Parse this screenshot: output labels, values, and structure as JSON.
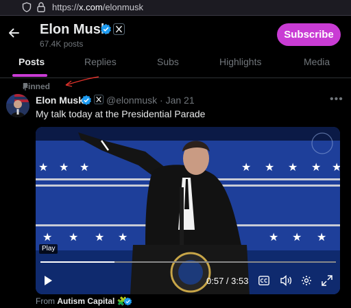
{
  "browser": {
    "url_prefix": "https://",
    "url_host": "x.com",
    "url_path": "/elonmusk"
  },
  "header": {
    "name": "Elon Musk",
    "post_count": "67.4K posts",
    "subscribe_label": "Subscribe"
  },
  "tabs": [
    {
      "label": "Posts",
      "active": true
    },
    {
      "label": "Replies",
      "active": false
    },
    {
      "label": "Subs",
      "active": false
    },
    {
      "label": "Highlights",
      "active": false
    },
    {
      "label": "Media",
      "active": false
    }
  ],
  "post": {
    "pinned_label": "Pinned",
    "author": "Elon Musk",
    "handle_date": "@elonmusk · Jan 21",
    "text": "My talk today at the Presidential Parade",
    "video": {
      "play_chip": "Play",
      "time": "0:57 / 3:53",
      "progress": 0.25
    },
    "from_prefix": "From",
    "from_source": "Autism Capital",
    "from_emoji": "🧩"
  },
  "colors": {
    "accent": "#c93cd4",
    "verified": "#1d9bf0",
    "annotation": "#e0322b"
  }
}
